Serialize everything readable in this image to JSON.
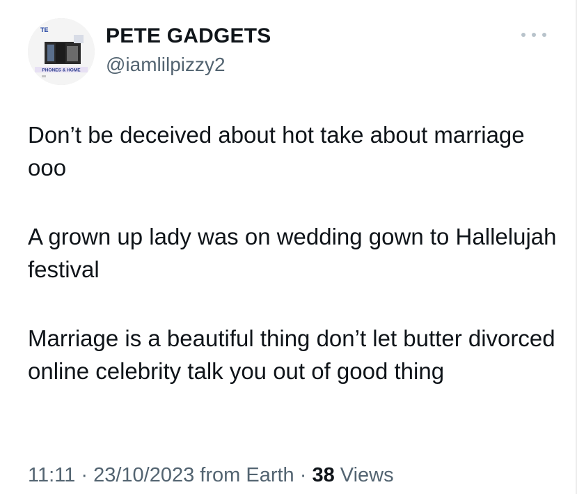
{
  "tweet": {
    "author": {
      "name": "PETE GADGETS",
      "handle": "@iamlilpizzy2",
      "avatar_text": "PHONES & HOME"
    },
    "body": [
      "Don’t be deceived about hot take about marriage ooo",
      "A grown up lady was on wedding gown to Hallelujah festival",
      "Marriage is a beautiful thing don’t let butter divorced online celebrity talk you out of good thing"
    ],
    "meta": {
      "time": "11:11",
      "separator": "·",
      "date": "23/10/2023",
      "source": "from Earth",
      "views_count": "38",
      "views_label": "Views"
    },
    "more_icon": "more-horizontal-icon"
  },
  "colors": {
    "text_primary": "#0f1419",
    "text_secondary": "#536471",
    "icon_muted": "#b8c3cb"
  }
}
